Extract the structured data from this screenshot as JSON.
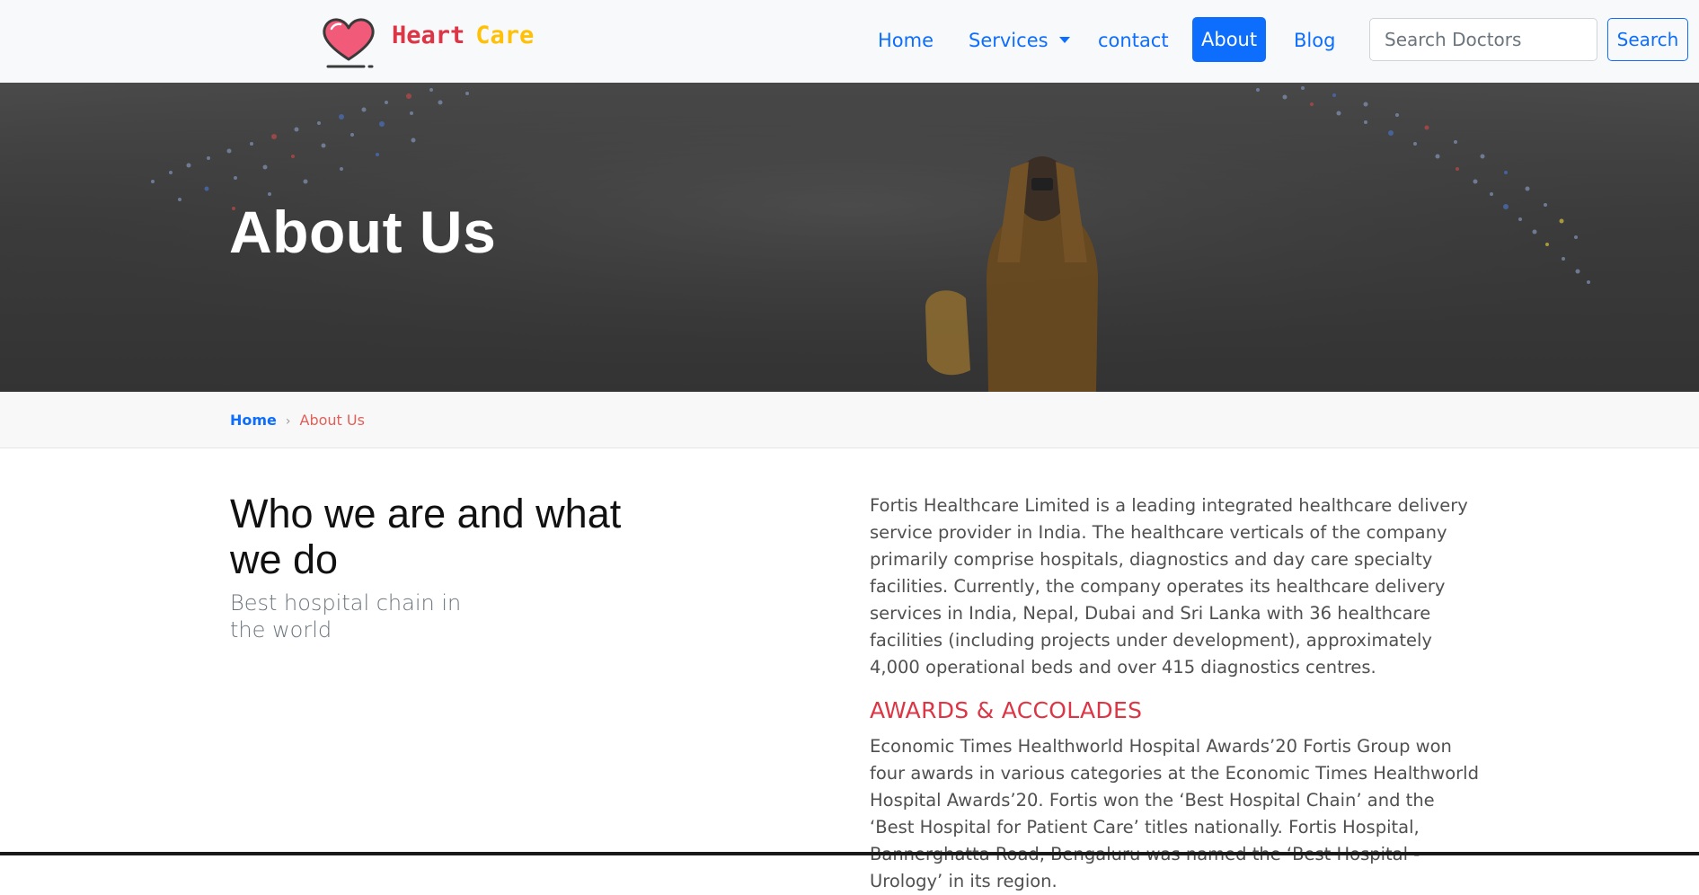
{
  "navbar": {
    "brand_word1": "Heart",
    "brand_word2": "Care",
    "logo_icon": "heart-icon",
    "links": [
      {
        "label": "Home"
      },
      {
        "label": "Services"
      },
      {
        "label": "contact"
      },
      {
        "label": "About",
        "active": true
      },
      {
        "label": "Blog"
      }
    ],
    "search_placeholder": "Search Doctors",
    "search_button": "Search",
    "colors": {
      "primary": "#0d6efd",
      "brand_red": "#dc3545",
      "brand_yellow": "#ffc107"
    }
  },
  "hero": {
    "title": "About Us"
  },
  "breadcrumb": {
    "home": "Home",
    "separator": "›",
    "current": "About Us"
  },
  "content": {
    "heading": "Who we are and what we do",
    "subheading": "Best hospital chain in the world",
    "intro": "Fortis Healthcare Limited is a leading integrated healthcare delivery service provider in India. The healthcare verticals of the company primarily comprise hospitals, diagnostics and day care specialty facilities. Currently, the company operates its healthcare delivery services in India, Nepal, Dubai and Sri Lanka with 36 healthcare facilities (including projects under development), approximately 4,000 operational beds and over 415 diagnostics centres.",
    "awards_heading": "AWARDS & ACCOLADES",
    "awards_text": "Economic Times Healthworld Hospital Awards’20 Fortis Group won four awards in various categories at the Economic Times Healthworld Hospital Awards’20. Fortis won the ‘Best Hospital Chain’ and the ‘Best Hospital for Patient Care’ titles nationally. Fortis Hospital, Bannerghatta Road, Bengaluru was named the ‘Best Hospital - Urology’ in its region."
  }
}
